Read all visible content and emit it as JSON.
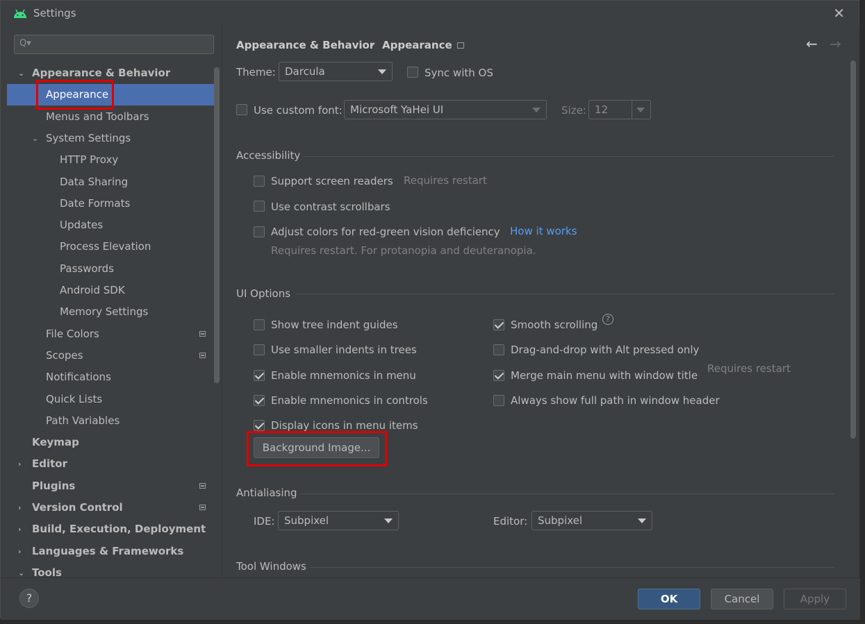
{
  "window": {
    "title": "Settings",
    "close_glyph": "✕",
    "app_icon": "android-icon"
  },
  "search": {
    "placeholder": "",
    "glyph": "Q▾"
  },
  "sidebar": {
    "items": [
      {
        "label": "Appearance & Behavior",
        "bold": true,
        "arrow": "⌄"
      },
      {
        "label": "Appearance",
        "selected": true
      },
      {
        "label": "Menus and Toolbars"
      },
      {
        "label": "System Settings",
        "arrow": "⌄"
      },
      {
        "label": "HTTP Proxy"
      },
      {
        "label": "Data Sharing"
      },
      {
        "label": "Date Formats"
      },
      {
        "label": "Updates"
      },
      {
        "label": "Process Elevation"
      },
      {
        "label": "Passwords"
      },
      {
        "label": "Android SDK"
      },
      {
        "label": "Memory Settings"
      },
      {
        "label": "File Colors",
        "badge": true
      },
      {
        "label": "Scopes",
        "badge": true
      },
      {
        "label": "Notifications"
      },
      {
        "label": "Quick Lists"
      },
      {
        "label": "Path Variables"
      },
      {
        "label": "Keymap",
        "bold": true
      },
      {
        "label": "Editor",
        "bold": true,
        "arrow": "›"
      },
      {
        "label": "Plugins",
        "bold": true,
        "badge": true
      },
      {
        "label": "Version Control",
        "bold": true,
        "arrow": "›",
        "badge": true
      },
      {
        "label": "Build, Execution, Deployment",
        "bold": true,
        "arrow": "›"
      },
      {
        "label": "Languages & Frameworks",
        "bold": true,
        "arrow": "›"
      },
      {
        "label": "Tools",
        "bold": true,
        "arrow": "⌄"
      }
    ]
  },
  "header": {
    "crumb_1": "Appearance & Behavior",
    "separator": "›",
    "crumb_2": "Appearance",
    "back_glyph": "←",
    "forward_glyph": "→"
  },
  "theme": {
    "label": "Theme:",
    "value": "Darcula",
    "sync_label": "Sync with OS",
    "sync_checked": false
  },
  "font": {
    "checkbox_label": "Use custom font:",
    "value": "Microsoft YaHei UI",
    "size_label": "Size:",
    "size_value": "12",
    "checked": false
  },
  "accessibility": {
    "title": "Accessibility",
    "screen_readers": "Support screen readers",
    "screen_readers_note": "Requires restart",
    "contrast_scrollbars": "Use contrast scrollbars",
    "adjust_colors": "Adjust colors for red-green vision deficiency",
    "how_it_works": "How it works",
    "adjust_note": "Requires restart. For protanopia and deuteranopia."
  },
  "ui_options": {
    "title": "UI Options",
    "left": [
      {
        "label": "Show tree indent guides",
        "checked": false
      },
      {
        "label": "Use smaller indents in trees",
        "checked": false
      },
      {
        "label": "Enable mnemonics in menu",
        "checked": true
      },
      {
        "label": "Enable mnemonics in controls",
        "checked": true
      },
      {
        "label": "Display icons in menu items",
        "checked": true
      }
    ],
    "right": [
      {
        "label": "Smooth scrolling",
        "checked": true
      },
      {
        "label": "Drag-and-drop with Alt pressed only",
        "checked": false
      },
      {
        "label": "Merge main menu with window title",
        "checked": true
      },
      {
        "label": "Always show full path in window header",
        "checked": false
      }
    ],
    "merge_note": "Requires restart",
    "help_glyph": "?",
    "background_button": "Background Image..."
  },
  "antialiasing": {
    "title": "Antialiasing",
    "ide_label": "IDE:",
    "ide_value": "Subpixel",
    "editor_label": "Editor:",
    "editor_value": "Subpixel"
  },
  "tool_windows": {
    "title": "Tool Windows"
  },
  "footer": {
    "help": "?",
    "ok": "OK",
    "cancel": "Cancel",
    "apply": "Apply"
  },
  "colors": {
    "selection": "#4b6eaf",
    "highlight_box": "#e00000",
    "link": "#589df6",
    "ok_button": "#365880"
  }
}
